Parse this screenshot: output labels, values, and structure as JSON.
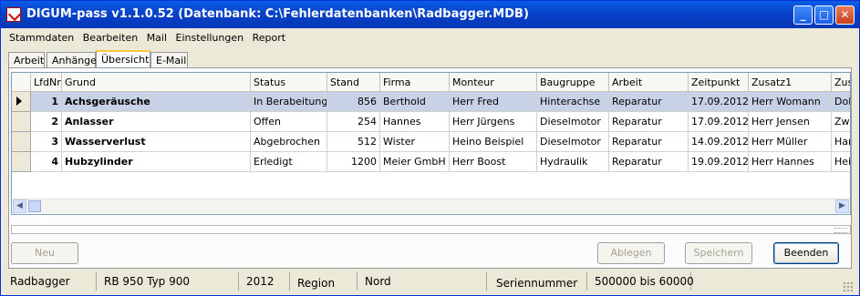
{
  "window": {
    "title": "DIGUM-pass v1.1.0.52 (Datenbank: C:\\Fehlerdatenbanken\\Radbagger.MDB)"
  },
  "menu": [
    "Stammdaten",
    "Bearbeiten",
    "Mail",
    "Einstellungen",
    "Report"
  ],
  "tabs": [
    "Arbeit",
    "Anhänge",
    "Übersicht",
    "E-Mail"
  ],
  "active_tab": "Übersicht",
  "grid": {
    "columns": [
      "LfdNr",
      "Grund",
      "Status",
      "Stand",
      "Firma",
      "Monteur",
      "Baugruppe",
      "Arbeit",
      "Zeitpunkt",
      "Zusatz1",
      "Zus"
    ],
    "rows": [
      [
        "1",
        "Achsgeräusche",
        "In Berabeitung",
        "856",
        "Berthold",
        "Herr Fred",
        "Hinterachse",
        "Reparatur",
        "17.09.2012",
        "Herr Womann",
        "Dol"
      ],
      [
        "2",
        "Anlasser",
        "Offen",
        "254",
        "Hannes",
        "Herr Jürgens",
        "Dieselmotor",
        "Reparatur",
        "17.09.2012",
        "Herr Jensen",
        "Zwi"
      ],
      [
        "3",
        "Wasserverlust",
        "Abgebrochen",
        "512",
        "Wister",
        "Heino Beispiel",
        "Dieselmotor",
        "Reparatur",
        "14.09.2012",
        "Herr Müller",
        "Har"
      ],
      [
        "4",
        "Hubzylinder",
        "Erledigt",
        "1200",
        "Meier GmbH",
        "Herr Boost",
        "Hydraulik",
        "Reparatur",
        "19.09.2012",
        "Herr Hannes",
        "Hei"
      ]
    ],
    "selected_row": 0
  },
  "buttons": {
    "new": "Neu",
    "discard": "Ablegen",
    "save": "Speichern",
    "exit": "Beenden"
  },
  "statusbar": [
    "Radbagger",
    "RB 950 Typ 900",
    "2012",
    "Region",
    "Nord",
    "Seriennummer",
    "500000 bis 60000"
  ],
  "colors": {
    "titlebar": "#0842c8",
    "selected_row": "#c7d2e6",
    "window_bg": "#ece9d8"
  }
}
